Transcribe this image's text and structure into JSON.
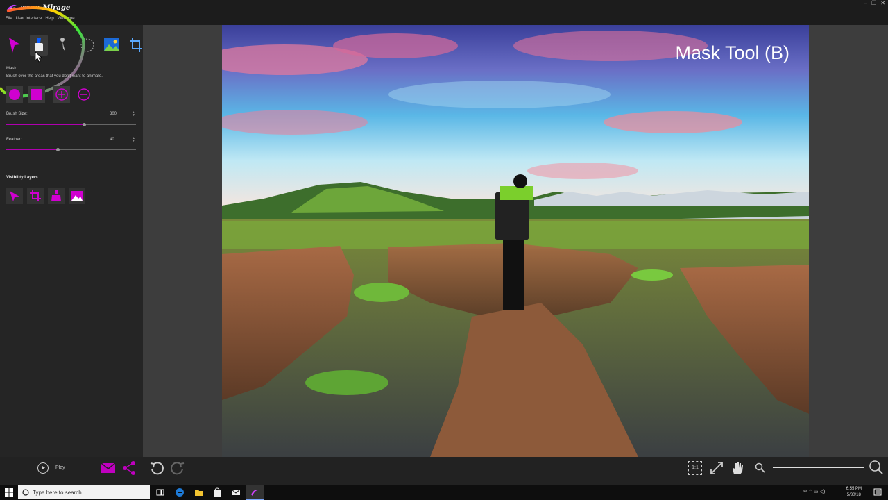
{
  "app": {
    "logo_prefix": "PHOTO",
    "logo_name": "Mirage",
    "menu": [
      "File",
      "User Interface",
      "Help",
      "Welcome"
    ],
    "window_controls": [
      "–",
      "❐",
      "✕"
    ]
  },
  "sidebar": {
    "tools": [
      "motion-arrow",
      "mask-brush",
      "anchor-pin",
      "selection",
      "overlay-image",
      "crop"
    ],
    "mask_title": "Mask:",
    "mask_desc": "Brush over the areas that you don't want to animate.",
    "brush_size_label": "Brush Size:",
    "brush_size_value": "300",
    "brush_size_fraction": 0.6,
    "feather_label": "Feather:",
    "feather_value": "40",
    "feather_fraction": 0.4,
    "visibility_title": "Visibility Layers"
  },
  "canvas": {
    "overlay_label": "Mask Tool (B)"
  },
  "bottom": {
    "play_label": "Play",
    "zoom_label": "1:1"
  },
  "taskbar": {
    "search_placeholder": "Type here to search",
    "time": "6:55 PM",
    "date": "5/30/18"
  },
  "colors": {
    "accent": "#c000c0",
    "sidebar": "#252525",
    "canvas": "#3d3d3d"
  }
}
